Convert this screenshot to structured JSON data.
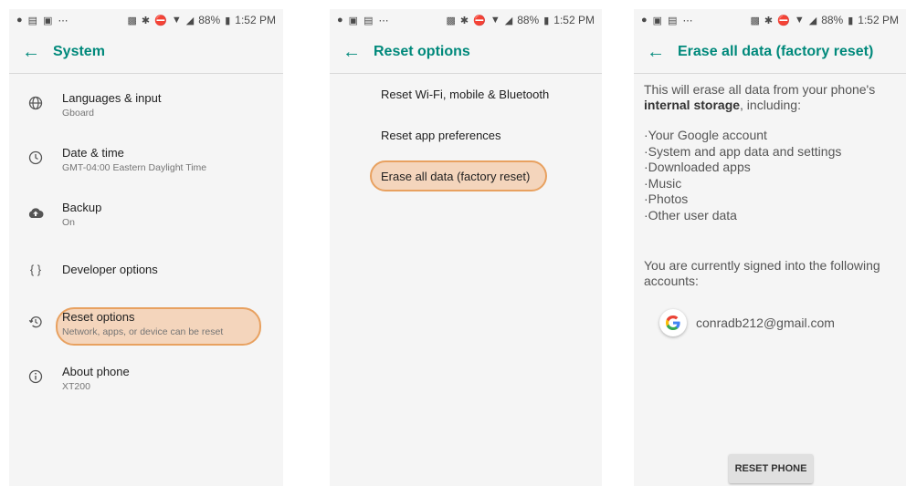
{
  "status": {
    "battery": "88%",
    "time": "1:52 PM"
  },
  "screen1": {
    "title": "System",
    "items": [
      {
        "icon": "globe-icon",
        "title": "Languages & input",
        "subtitle": "Gboard"
      },
      {
        "icon": "clock-icon",
        "title": "Date & time",
        "subtitle": "GMT-04:00 Eastern Daylight Time"
      },
      {
        "icon": "cloud-upload-icon",
        "title": "Backup",
        "subtitle": "On"
      },
      {
        "icon": "braces-icon",
        "title": "Developer options",
        "subtitle": ""
      },
      {
        "icon": "history-icon",
        "title": "Reset options",
        "subtitle": "Network, apps, or device can be reset"
      },
      {
        "icon": "info-icon",
        "title": "About phone",
        "subtitle": "XT200"
      }
    ]
  },
  "screen2": {
    "title": "Reset options",
    "options": [
      "Reset Wi-Fi, mobile & Bluetooth",
      "Reset app preferences",
      "Erase all data (factory reset)"
    ]
  },
  "screen3": {
    "title": "Erase all data (factory reset)",
    "intro_a": "This will erase all data from your phone's",
    "intro_b": "internal storage",
    "intro_c": ", including:",
    "list": [
      "Your Google account",
      "System and app data and settings",
      "Downloaded apps",
      "Music",
      "Photos",
      "Other user data"
    ],
    "signed_in": "You are currently signed into the following accounts:",
    "account": "conradb212@gmail.com",
    "button": "RESET PHONE"
  },
  "colors": {
    "accent": "#00897b",
    "highlight": "#f4b078"
  }
}
